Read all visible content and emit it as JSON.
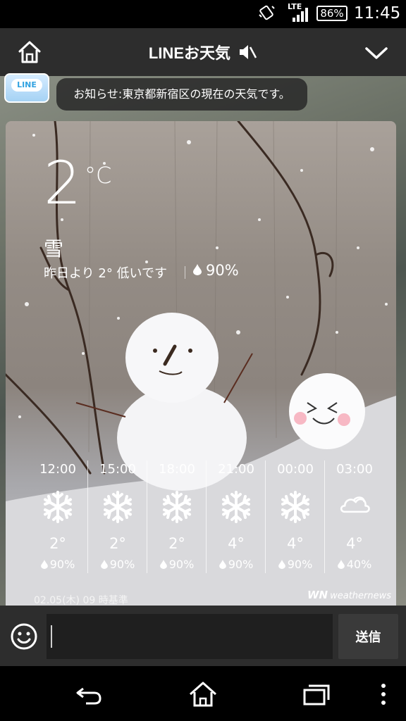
{
  "status_bar": {
    "network": "LTE",
    "battery": "86%",
    "time": "11:45"
  },
  "header": {
    "title": "LINEお天気",
    "icons": [
      "home-icon",
      "mute-icon",
      "chevron-down-icon"
    ]
  },
  "chat": {
    "avatar_label": "LINE",
    "notice": "お知らせ:東京都新宿区の現在の天気です。"
  },
  "weather": {
    "temperature": "2",
    "unit": "°C",
    "condition": "雪",
    "comparison": "昨日より 2° 低いです",
    "precipitation": "90%",
    "forecast": [
      {
        "time": "12:00",
        "icon": "snow-icon",
        "temp": "2°",
        "prob": "90%"
      },
      {
        "time": "15:00",
        "icon": "snow-icon",
        "temp": "2°",
        "prob": "90%"
      },
      {
        "time": "18:00",
        "icon": "snow-icon",
        "temp": "2°",
        "prob": "90%"
      },
      {
        "time": "21:00",
        "icon": "snow-icon",
        "temp": "4°",
        "prob": "90%"
      },
      {
        "time": "00:00",
        "icon": "snow-icon",
        "temp": "4°",
        "prob": "90%"
      },
      {
        "time": "03:00",
        "icon": "cloudy-icon",
        "temp": "4°",
        "prob": "40%"
      }
    ],
    "footnote": "02.05(木) 09 時基準",
    "provider_logo": "WN",
    "provider_name": "weathernews"
  },
  "input_bar": {
    "placeholder": "",
    "send_label": "送信"
  },
  "nav": {
    "icons": [
      "back-icon",
      "home-icon",
      "recent-apps-icon",
      "menu-icon"
    ]
  },
  "colors": {
    "header_bg": "#2d2d2d",
    "line_blue": "#31a2e0"
  }
}
